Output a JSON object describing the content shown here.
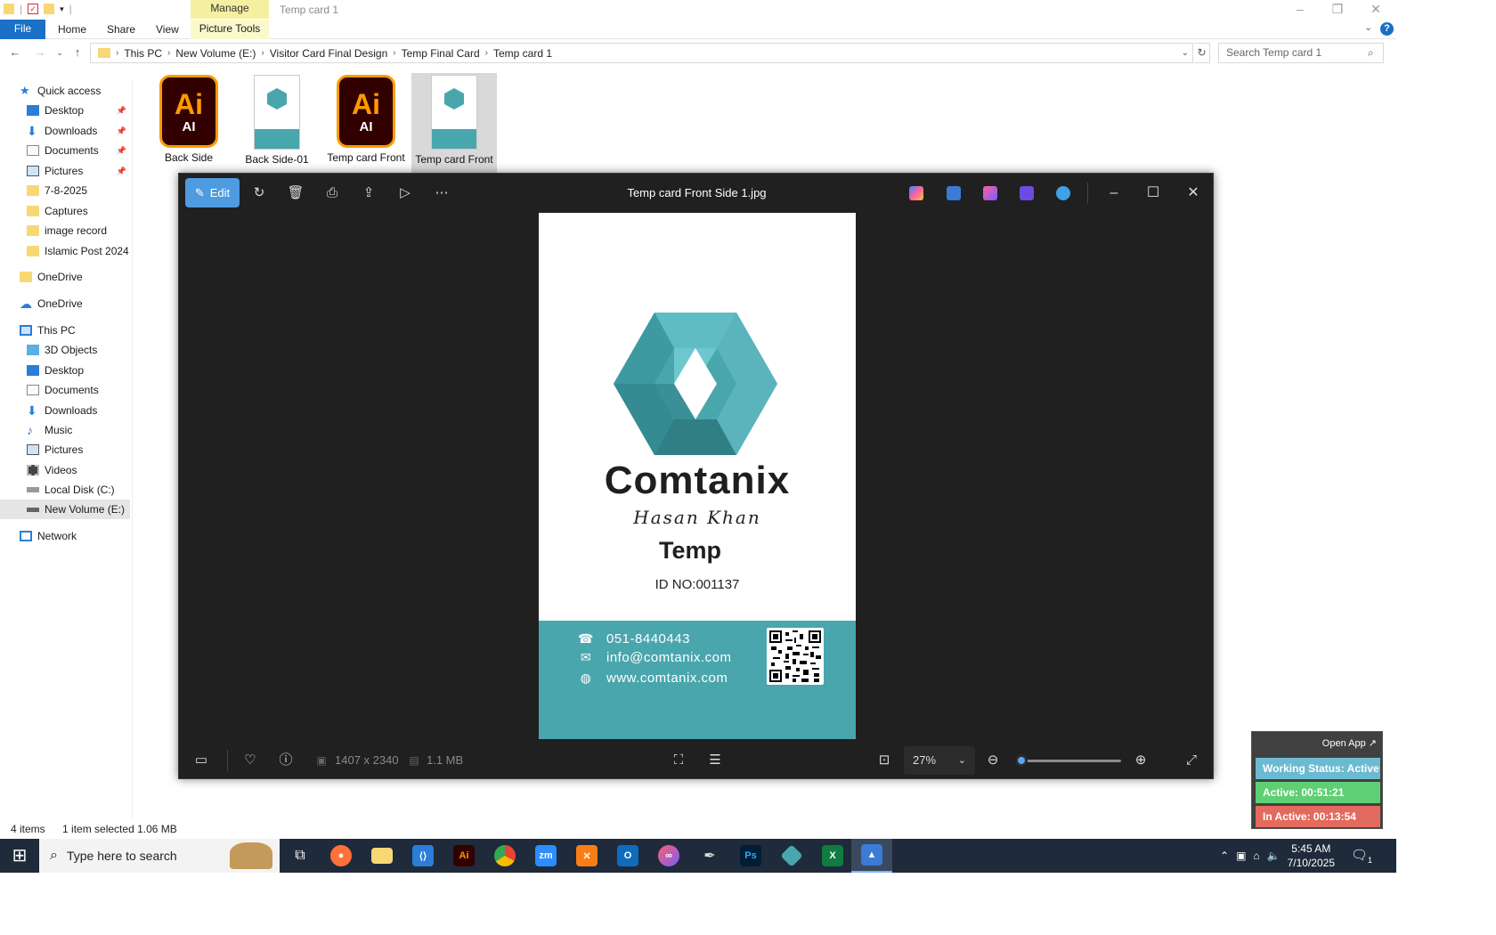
{
  "window": {
    "title": "Temp  card 1",
    "manage_tab": "Manage",
    "picture_tools_tab": "Picture Tools"
  },
  "ribbon": {
    "file": "File",
    "home": "Home",
    "share": "Share",
    "view": "View"
  },
  "address": {
    "crumbs": [
      "This PC",
      "New Volume (E:)",
      "Visitor Card Final Design",
      "Temp Final Card",
      "Temp  card 1"
    ],
    "search_placeholder": "Search Temp  card 1"
  },
  "nav": {
    "quick_access": "Quick access",
    "qa_items": [
      "Desktop",
      "Downloads",
      "Documents",
      "Pictures",
      "7-8-2025",
      "Captures",
      "image record",
      "Islamic Post 2024"
    ],
    "onedrive1": "OneDrive",
    "onedrive2": "OneDrive",
    "this_pc": "This PC",
    "pc_items": [
      "3D Objects",
      "Desktop",
      "Documents",
      "Downloads",
      "Music",
      "Pictures",
      "Videos",
      "Local Disk (C:)",
      "New Volume (E:)"
    ],
    "network": "Network"
  },
  "files": [
    {
      "name": "Back Side",
      "type": "ai"
    },
    {
      "name": "Back Side-01",
      "type": "image"
    },
    {
      "name": "Temp  card Front Side 1",
      "type": "ai"
    },
    {
      "name": "Temp  card Front Side 1",
      "type": "image"
    }
  ],
  "status": {
    "count": "4 items",
    "selected": "1 item selected  1.06 MB"
  },
  "viewer": {
    "edit": "Edit",
    "filename": "Temp  card Front Side 1.jpg",
    "dimensions": "1407 x 2340",
    "size": "1.1 MB",
    "zoom": "27%",
    "zoom_level": 0.05
  },
  "card": {
    "brand": "Comtanix",
    "signature": "Hasan Khan",
    "name": "Temp",
    "id": "ID NO:001137",
    "phone": "051-8440443",
    "email": "info@comtanix.com",
    "web": "www.comtanix.com",
    "accent": "#4aa6ad"
  },
  "widget": {
    "open_app": "Open App ↗",
    "working": "Working Status: Active",
    "active": "Active: 00:51:21",
    "inactive": "In Active: 00:13:54"
  },
  "taskbar": {
    "search_placeholder": "Type here to search",
    "time": "5:45 AM",
    "date": "7/10/2025",
    "notifications": "1"
  }
}
